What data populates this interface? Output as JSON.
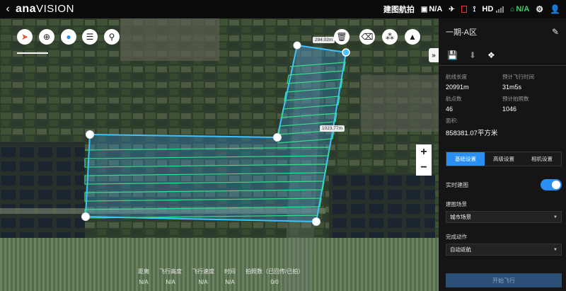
{
  "app": {
    "logo_a": "ana",
    "logo_b": "VISION"
  },
  "topbar": {
    "mode_label": "建图航拍",
    "camera_status": "N/A",
    "hd_label": "HD",
    "hd_status": "N/A",
    "accent_green": "#3fd16a"
  },
  "map": {
    "distance_top": "294.02m",
    "distance_right": "1023.77m",
    "toolbar_icons": [
      "compass-icon",
      "locate-icon",
      "pin-icon",
      "list-icon",
      "search-icon"
    ],
    "tools_right": [
      "trash-icon",
      "eraser-icon",
      "waypoints-icon",
      "plane-icon"
    ],
    "zoom_in": "+",
    "zoom_out": "−",
    "collapse": "»"
  },
  "stats": {
    "distance_label": "距离",
    "distance_value": "N/A",
    "altitude_label": "飞行高度",
    "altitude_value": "N/A",
    "speed_label": "飞行速度",
    "speed_value": "N/A",
    "time_label": "时间",
    "time_value": "N/A",
    "photos_label": "拍照数（已回传/已拍）",
    "photos_value": "0/0"
  },
  "panel": {
    "title": "一期-A区",
    "route_length_label": "航线长度",
    "route_length_value": "20991m",
    "flight_time_label": "预计飞行时间",
    "flight_time_value": "31m5s",
    "waypoints_label": "航点数",
    "waypoints_value": "46",
    "photos_label": "预计拍照数",
    "photos_value": "1046",
    "area_label": "面积:",
    "area_value": "858381.07平方米",
    "tabs": [
      "基础设置",
      "高级设置",
      "相机设置"
    ],
    "realtime_label": "实时建图",
    "scene_label": "建图场景",
    "scene_value": "城市场景",
    "finish_label": "完成动作",
    "finish_value": "自动返航",
    "start_button": "开始飞行",
    "accent_blue": "#2a8ff0"
  }
}
